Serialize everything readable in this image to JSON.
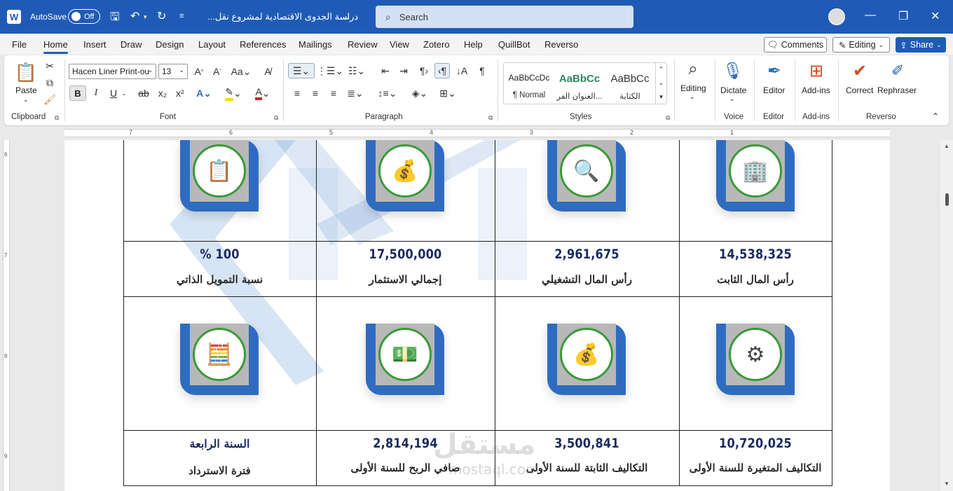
{
  "titlebar": {
    "app_icon": "W",
    "autosave_label": "AutoSave",
    "autosave_state": "Off",
    "doc_title": "دراسة الجدوى الاقتصادية لمشروع نقل...",
    "search_placeholder": "Search"
  },
  "menu": {
    "tabs": [
      "File",
      "Home",
      "Insert",
      "Draw",
      "Design",
      "Layout",
      "References",
      "Mailings",
      "Review",
      "View",
      "Zotero",
      "Help",
      "QuillBot",
      "Reverso"
    ],
    "active_tab": "Home",
    "comments": "Comments",
    "editing": "Editing",
    "share": "Share"
  },
  "ribbon": {
    "clipboard": {
      "paste": "Paste",
      "label": "Clipboard"
    },
    "font": {
      "name": "Hacen Liner Print-ou",
      "size": "13",
      "label": "Font",
      "bold": "B",
      "italic": "I",
      "underline": "U"
    },
    "paragraph": {
      "label": "Paragraph"
    },
    "styles": {
      "label": "Styles",
      "items": [
        {
          "preview": "AaBbCcDc",
          "name": "¶ Normal"
        },
        {
          "preview": "AaBbCc",
          "name": "العنوان الفر..."
        },
        {
          "preview": "AaBbCc",
          "name": "الكتابة"
        }
      ]
    },
    "editing": {
      "label": "Editing"
    },
    "voice": {
      "dictate": "Dictate",
      "label": "Voice"
    },
    "editor": {
      "editor": "Editor",
      "label": "Editor"
    },
    "addins": {
      "addins": "Add-ins",
      "label": "Add-ins"
    },
    "reverso": {
      "correct": "Correct",
      "rephraser": "Rephraser",
      "label": "Reverso"
    }
  },
  "ruler": {
    "h_numbers": [
      "7",
      "6",
      "5",
      "4",
      "3",
      "2",
      "1"
    ],
    "v_numbers": [
      "6",
      "7",
      "8",
      "9"
    ]
  },
  "table": {
    "row1": [
      {
        "value": "14,538,325",
        "label": "رأس المال الثابت"
      },
      {
        "value": "2,961,675",
        "label": "رأس المال التشغيلي"
      },
      {
        "value": "17,500,000",
        "label": "إجمالي الاستثمار"
      },
      {
        "value": "% 100",
        "label": "نسبة التمويل الذاتي"
      }
    ],
    "row2": [
      {
        "value": "10,720,025",
        "label": "التكاليف المتغيرة للسنة الأولى"
      },
      {
        "value": "3,500,841",
        "label": "التكاليف الثابتة للسنة الأولى"
      },
      {
        "value": "2,814,194",
        "label": "صافي الربح للسنة الأولى"
      },
      {
        "value": "السنة الرابعة",
        "label": "فترة الاسترداد"
      }
    ]
  },
  "watermark": {
    "arabic": "مستقل",
    "latin": "mostaql.com"
  },
  "colors": {
    "titlebar": "#1f5bb6",
    "icon_frame": "#2f6cc0",
    "icon_ring": "#3a9a3a",
    "number_text": "#1b2a5e"
  },
  "icons": {
    "row1": [
      "building-growth-icon",
      "finance-search-icon",
      "money-bag-icon",
      "clipboard-checklist-icon"
    ],
    "row2": [
      "chart-gear-icon",
      "money-bag-icon",
      "cash-hand-icon",
      "calculator-gear-icon"
    ]
  }
}
